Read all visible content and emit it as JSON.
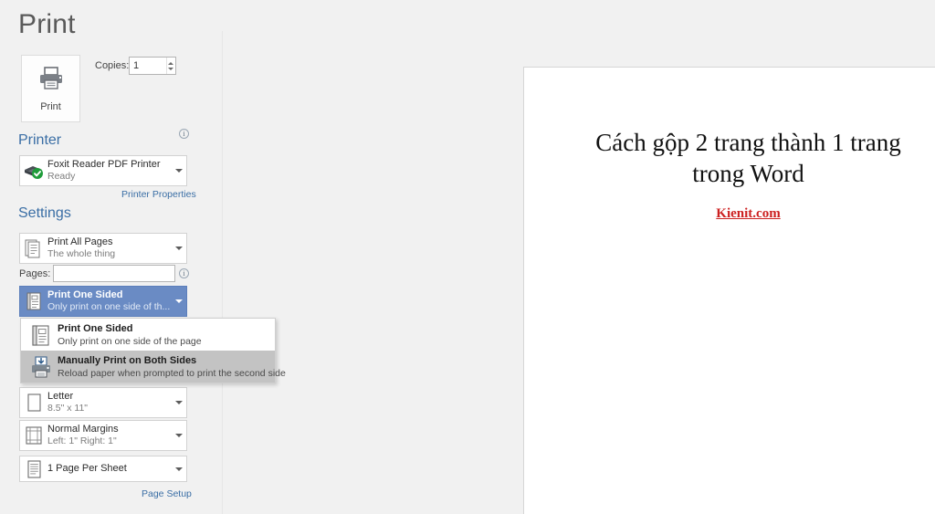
{
  "window": {
    "title": "Print"
  },
  "print_action": {
    "button_label": "Print",
    "icon": "printer-icon",
    "copies_label": "Copies:",
    "copies_value": "1"
  },
  "printer_section": {
    "heading": "Printer",
    "info_icon": "info-icon",
    "selected": {
      "name": "Foxit Reader PDF Printer",
      "status": "Ready",
      "icon": "printer-ready-icon"
    },
    "properties_link": "Printer Properties"
  },
  "settings_section": {
    "heading": "Settings",
    "print_range": {
      "title": "Print All Pages",
      "subtitle": "The whole thing",
      "icon": "pages-icon"
    },
    "pages": {
      "label": "Pages:",
      "value": "",
      "placeholder": "",
      "info_icon": "info-icon"
    },
    "sides": {
      "title": "Print One Sided",
      "subtitle": "Only print on one side of th...",
      "icon": "one-sided-icon",
      "expanded": true,
      "options": [
        {
          "title": "Print One Sided",
          "subtitle": "Only print on one side of the page",
          "icon": "one-sided-icon",
          "highlighted": false
        },
        {
          "title": "Manually Print on Both Sides",
          "subtitle": "Reload paper when prompted to print the second side",
          "icon": "both-sides-printer-icon",
          "highlighted": true
        }
      ]
    },
    "paper_size": {
      "title": "Letter",
      "subtitle": "8.5\" x 11\"",
      "icon": "paper-icon"
    },
    "margins": {
      "title": "Normal Margins",
      "subtitle": "Left:  1\"    Right:  1\"",
      "icon": "margins-icon"
    },
    "scaling": {
      "title": "1 Page Per Sheet",
      "subtitle": "",
      "icon": "pages-per-sheet-icon"
    },
    "page_setup_link": "Page Setup"
  },
  "preview": {
    "document_title": "Cách gộp 2 trang thành 1 trang trong Word",
    "document_subtitle": "Kienit.com"
  },
  "colors": {
    "app_background": "#f1f1f1",
    "accent_blue": "#3a6ea5",
    "selected_blue": "#6a8bc4",
    "highlight_gray": "#c3c3c3",
    "subtitle_red": "#cc2020"
  }
}
